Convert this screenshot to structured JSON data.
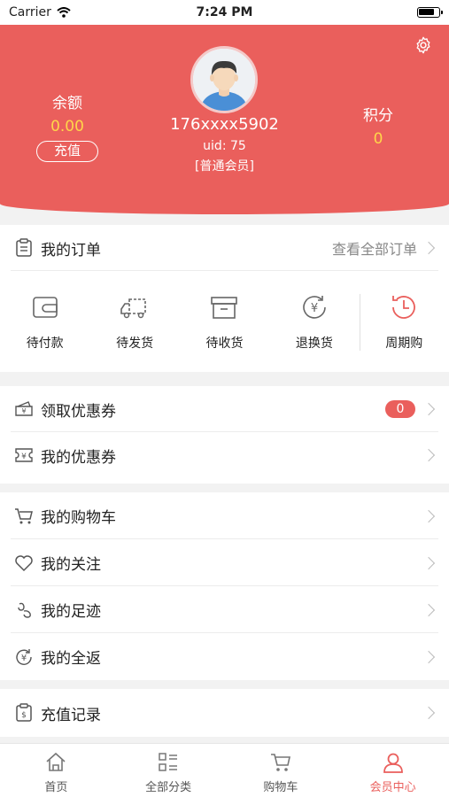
{
  "status_bar": {
    "carrier": "Carrier",
    "time": "7:24 PM"
  },
  "header": {
    "balance_label": "余额",
    "balance_value": "0.00",
    "recharge_label": "充值",
    "points_label": "积分",
    "points_value": "0",
    "phone": "176xxxx5902",
    "uid": "uid: 75",
    "level": "[普通会员]",
    "accent_color": "#ea5f5c",
    "value_color": "#ffd54a"
  },
  "orders": {
    "title": "我的订单",
    "view_all": "查看全部订单",
    "statuses": [
      {
        "label": "待付款",
        "icon": "wallet-icon"
      },
      {
        "label": "待发货",
        "icon": "truck-icon"
      },
      {
        "label": "待收货",
        "icon": "box-icon"
      },
      {
        "label": "退换货",
        "icon": "refund-icon"
      },
      {
        "label": "周期购",
        "icon": "clock-icon"
      }
    ]
  },
  "coupons": {
    "claim_label": "领取优惠券",
    "claim_count": "0",
    "mine_label": "我的优惠券"
  },
  "list": {
    "cart": "我的购物车",
    "follow": "我的关注",
    "footprint": "我的足迹",
    "rebate": "我的全返"
  },
  "recharge_log": "充值记录",
  "tabbar": {
    "home": "首页",
    "categories": "全部分类",
    "cart": "购物车",
    "member": "会员中心"
  }
}
